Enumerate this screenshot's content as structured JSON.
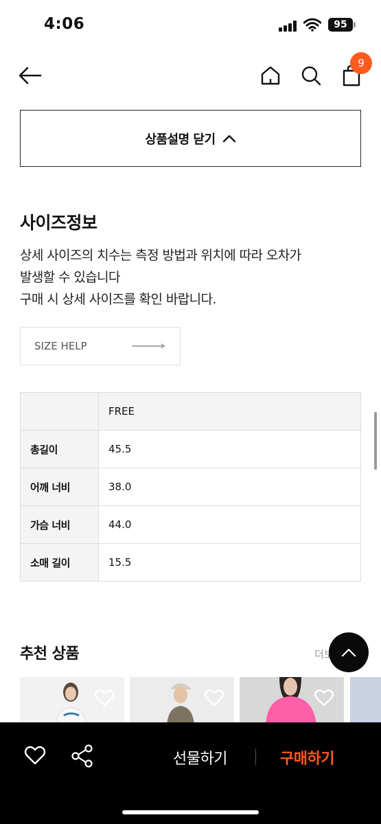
{
  "status_bar": {
    "time": "4:06",
    "battery": "95"
  },
  "header": {
    "cart_count": "9"
  },
  "close_description": {
    "label": "상품설명 닫기"
  },
  "size_info": {
    "title": "사이즈정보",
    "description_lines": [
      "상세 사이즈의 치수는 측정 방법과 위치에 따라 오차가",
      "발생할 수 있습니다",
      "구매 시 상세 사이즈를 확인 바랍니다."
    ],
    "size_help_label": "SIZE HELP",
    "table": {
      "column_header": "FREE",
      "rows": [
        {
          "label": "총길이",
          "value": "45.5"
        },
        {
          "label": "어깨 너비",
          "value": "38.0"
        },
        {
          "label": "가슴 너비",
          "value": "44.0"
        },
        {
          "label": "소매 길이",
          "value": "15.5"
        }
      ]
    }
  },
  "recommended": {
    "title": "추천 상품",
    "more_label": "더보"
  },
  "bottom_bar": {
    "gift_label": "선물하기",
    "buy_label": "구매하기"
  },
  "colors": {
    "accent": "#ff5a1f",
    "bar_bg": "#000000"
  }
}
